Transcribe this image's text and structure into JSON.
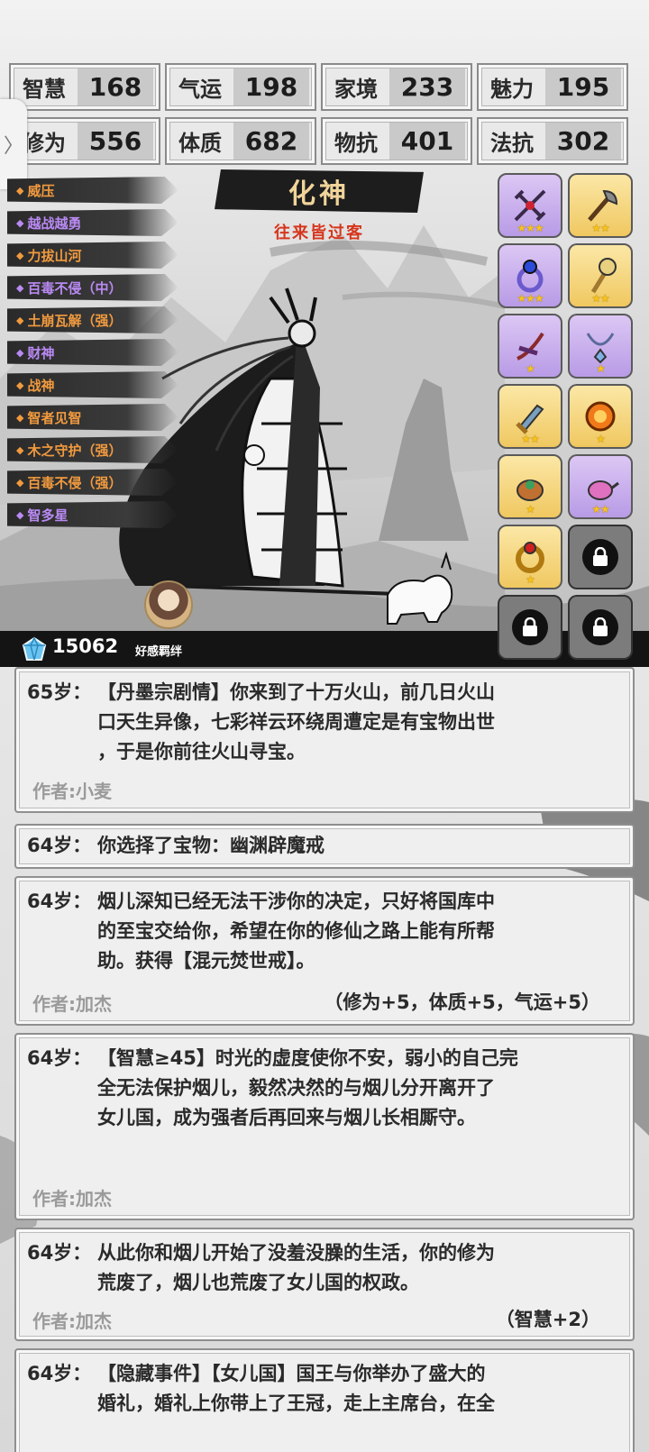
{
  "stats": [
    {
      "name": "智慧",
      "value": "168"
    },
    {
      "name": "气运",
      "value": "198"
    },
    {
      "name": "家境",
      "value": "233"
    },
    {
      "name": "魅力",
      "value": "195"
    },
    {
      "name": "修为",
      "value": "556"
    },
    {
      "name": "体质",
      "value": "682"
    },
    {
      "name": "物抗",
      "value": "401"
    },
    {
      "name": "法抗",
      "value": "302"
    }
  ],
  "side_tab_icon": "chevron-right-icon",
  "traits": [
    {
      "label": "威压",
      "color": "#f19a3e"
    },
    {
      "label": "越战越勇",
      "color": "#b98af3"
    },
    {
      "label": "力拔山河",
      "color": "#f19a3e"
    },
    {
      "label": "百毒不侵（中）",
      "color": "#b98af3"
    },
    {
      "label": "土崩瓦解（强）",
      "color": "#f19a3e"
    },
    {
      "label": "财神",
      "color": "#b98af3"
    },
    {
      "label": "战神",
      "color": "#f19a3e"
    },
    {
      "label": "智者见智",
      "color": "#f19a3e"
    },
    {
      "label": "木之守护（强）",
      "color": "#f19a3e"
    },
    {
      "label": "百毒不侵（强）",
      "color": "#f19a3e"
    },
    {
      "label": "智多星",
      "color": "#b98af3"
    }
  ],
  "realm": {
    "title": "化神",
    "subtitle": "往来皆过客"
  },
  "items": [
    {
      "icon": "crossbow-icon",
      "rarity": "purple",
      "stars": "★★★"
    },
    {
      "icon": "axe-icon",
      "rarity": "gold",
      "stars": "★★"
    },
    {
      "icon": "ring-icon",
      "rarity": "purple",
      "stars": "★★★"
    },
    {
      "icon": "staff-icon",
      "rarity": "gold",
      "stars": "★★"
    },
    {
      "icon": "bow-icon",
      "rarity": "purple",
      "stars": "★"
    },
    {
      "icon": "necklace-icon",
      "rarity": "purple",
      "stars": "★"
    },
    {
      "icon": "dagger-icon",
      "rarity": "gold",
      "stars": "★★"
    },
    {
      "icon": "orb-icon",
      "rarity": "gold",
      "stars": "★"
    },
    {
      "icon": "cauldron-icon",
      "rarity": "gold",
      "stars": "★"
    },
    {
      "icon": "teapot-icon",
      "rarity": "purple",
      "stars": "★★"
    },
    {
      "icon": "gold-ring-icon",
      "rarity": "gold",
      "stars": "★"
    },
    {
      "icon": "lock-icon",
      "rarity": "locked",
      "stars": ""
    },
    {
      "icon": "lock-icon",
      "rarity": "locked",
      "stars": ""
    },
    {
      "icon": "lock-icon",
      "rarity": "locked",
      "stars": ""
    }
  ],
  "footer": {
    "gems": "15062",
    "bond_label": "好感羁绊"
  },
  "log": [
    {
      "age": "65岁：",
      "lines": [
        "【丹墨宗剧情】你来到了十万火山，前几日火山",
        "口天生异像，七彩祥云环绕周遭定是有宝物出世",
        "，于是你前往火山寻宝。"
      ],
      "author": "作者:小麦",
      "effect": ""
    },
    {
      "age": "64岁：",
      "lines": [
        "你选择了宝物：幽渊辟魔戒"
      ],
      "author": "",
      "effect": ""
    },
    {
      "age": "64岁：",
      "lines": [
        "烟儿深知已经无法干涉你的决定，只好将国库中",
        "的至宝交给你，希望在你的修仙之路上能有所帮",
        "助。获得【混元焚世戒】。"
      ],
      "author": "作者:加杰",
      "effect": "（修为+5，体质+5，气运+5）"
    },
    {
      "age": "64岁：",
      "lines": [
        "【智慧≥45】时光的虚度使你不安，弱小的自己完",
        "全无法保护烟儿，毅然决然的与烟儿分开离开了",
        "女儿国，成为强者后再回来与烟儿长相厮守。"
      ],
      "author": "作者:加杰",
      "effect": ""
    },
    {
      "age": "64岁：",
      "lines": [
        "从此你和烟儿开始了没羞没臊的生活，你的修为",
        "荒废了，烟儿也荒废了女儿国的权政。"
      ],
      "author": "作者:加杰",
      "effect": "（智慧+2）"
    },
    {
      "age": "64岁：",
      "lines": [
        "【隐藏事件】【女儿国】国王与你举办了盛大的",
        "婚礼，婚礼上你带上了王冠，走上主席台，在全"
      ],
      "author": "",
      "effect": ""
    }
  ]
}
